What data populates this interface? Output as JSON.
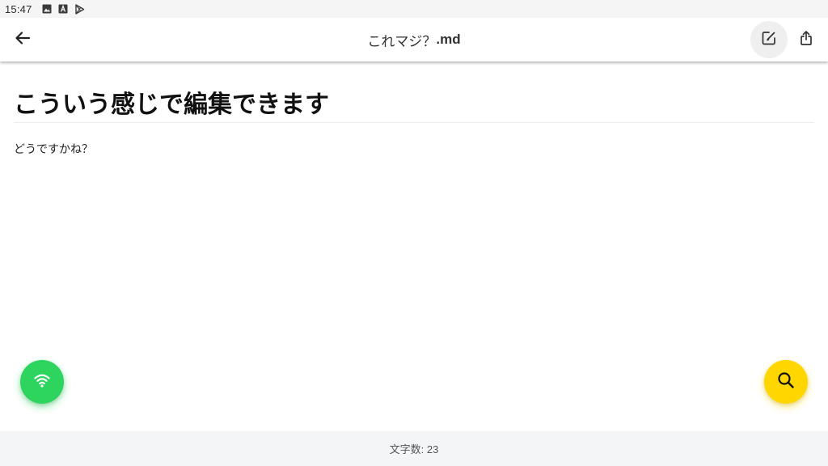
{
  "status_bar": {
    "time": "15:47",
    "icons": [
      "image-icon",
      "font-a-icon",
      "play-store-icon"
    ]
  },
  "app_bar": {
    "back_icon": "arrow-left-icon",
    "title_name": "これマジ？",
    "title_ext": ".md",
    "edit_icon": "edit-note-icon",
    "share_icon": "share-icon"
  },
  "document": {
    "heading": "こういう感じで編集できます",
    "paragraph": "どうですかね？"
  },
  "fabs": {
    "left_icon": "wifi-icon",
    "left_color": "#2dd45e",
    "right_icon": "search-icon",
    "right_color": "#ffd600"
  },
  "footer": {
    "char_count_text": "文字数: 23"
  }
}
